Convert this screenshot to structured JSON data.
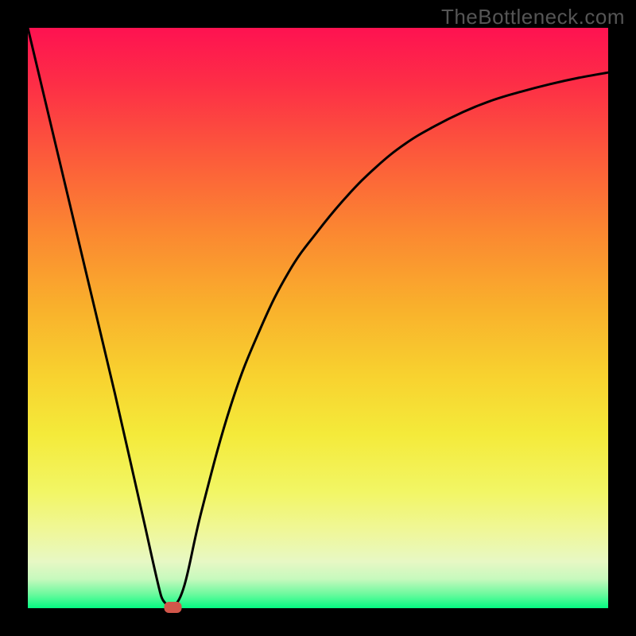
{
  "watermark": "TheBottleneck.com",
  "chart_data": {
    "type": "line",
    "title": "",
    "xlabel": "",
    "ylabel": "",
    "xlim": [
      0,
      100
    ],
    "ylim": [
      0,
      100
    ],
    "grid": false,
    "legend": false,
    "background_gradient": {
      "top": "#fe1251",
      "bottom": "#04fb82",
      "note": "continuous red→orange→yellow→green gradient"
    },
    "series": [
      {
        "name": "curve",
        "x": [
          0,
          5,
          10,
          15,
          20,
          23,
          25,
          27,
          30,
          35,
          40,
          45,
          50,
          55,
          60,
          65,
          70,
          75,
          80,
          85,
          90,
          95,
          100
        ],
        "y": [
          100,
          79,
          58,
          37,
          15,
          2,
          0,
          4,
          17,
          35,
          48,
          58,
          65,
          71,
          76,
          80,
          83,
          85.5,
          87.5,
          89,
          90.3,
          91.4,
          92.3
        ]
      }
    ],
    "marker": {
      "name": "minimum-marker",
      "x": 25,
      "y": 0,
      "color": "#d2564a",
      "shape": "rounded-rect"
    }
  }
}
